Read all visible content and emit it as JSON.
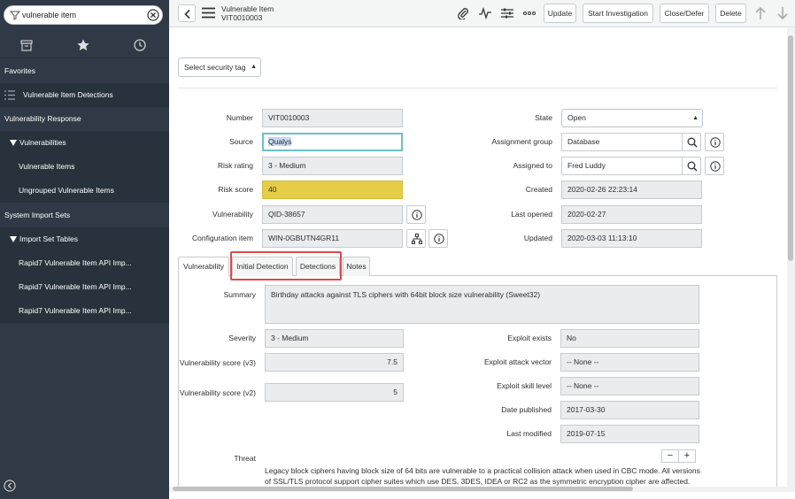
{
  "search": {
    "value": "vulnerable item"
  },
  "sidebar": {
    "items": [
      {
        "label": "Favorites"
      },
      {
        "label": "Vulnerable Item Detections"
      },
      {
        "label": "Vulnerability Response"
      },
      {
        "label": "Vulnerabilities"
      },
      {
        "label": "Vulnerable Items"
      },
      {
        "label": "Ungrouped Vulnerable Items"
      },
      {
        "label": "System Import Sets"
      },
      {
        "label": "Import Set Tables"
      },
      {
        "label": "Rapid7 Vulnerable Item API Imp..."
      },
      {
        "label": "Rapid7 Vulnerable Item API Imp..."
      },
      {
        "label": "Rapid7 Vulnerable Item API Imp..."
      }
    ]
  },
  "header": {
    "title": "Vulnerable Item",
    "subtitle": "VIT0010003",
    "buttons": {
      "update": "Update",
      "start_investigation": "Start Investigation",
      "close_defer": "Close/Defer",
      "delete": "Delete"
    }
  },
  "form": {
    "security_tag": "Select security tag",
    "number": {
      "label": "Number",
      "value": "VIT0010003"
    },
    "source": {
      "label": "Source",
      "value": "Qualys"
    },
    "risk_rating": {
      "label": "Risk rating",
      "value": "3 - Medium"
    },
    "risk_score": {
      "label": "Risk score",
      "value": "40"
    },
    "vulnerability": {
      "label": "Vulnerability",
      "value": "QID-38657"
    },
    "configuration_item": {
      "label": "Configuration item",
      "value": "WIN-0GBUTN4GR11"
    },
    "state": {
      "label": "State",
      "value": "Open"
    },
    "assignment_group": {
      "label": "Assignment group",
      "value": "Database"
    },
    "assigned_to": {
      "label": "Assigned to",
      "value": "Fred Luddy"
    },
    "created": {
      "label": "Created",
      "value": "2020-02-26 22:23:14"
    },
    "last_opened": {
      "label": "Last opened",
      "value": "2020-02-27"
    },
    "updated": {
      "label": "Updated",
      "value": "2020-03-03 11:13:10"
    }
  },
  "tabs": [
    {
      "label": "Vulnerability"
    },
    {
      "label": "Initial Detection"
    },
    {
      "label": "Detections"
    },
    {
      "label": "Notes"
    }
  ],
  "vuln_tab": {
    "summary": {
      "label": "Summary",
      "value": "Birthday attacks against TLS ciphers with 64bit block size vulnerability (Sweet32)"
    },
    "severity": {
      "label": "Severity",
      "value": "3 - Medium"
    },
    "score_v3": {
      "label": "Vulnerability score (v3)",
      "value": "7.5"
    },
    "score_v2": {
      "label": "Vulnerability score (v2)",
      "value": "5"
    },
    "exploit_exists": {
      "label": "Exploit exists",
      "value": "No"
    },
    "exploit_attack_vector": {
      "label": "Exploit attack vector",
      "value": "-- None --"
    },
    "exploit_skill_level": {
      "label": "Exploit skill level",
      "value": "-- None --"
    },
    "date_published": {
      "label": "Date published",
      "value": "2017-03-30"
    },
    "last_modified": {
      "label": "Last modified",
      "value": "2019-07-15"
    },
    "threat": {
      "label": "Threat",
      "value": "Legacy block ciphers having block size of 64 bits are vulnerable to a practical collision attack when used in CBC mode. All versions of SSL/TLS protocol support cipher suites which use DES, 3DES, IDEA or RC2 as the symmetric encryption cipher are affected."
    },
    "minus": "−",
    "plus": "+"
  },
  "colors": {
    "sidebar_bg": "#303a46",
    "highlight": "#e04848",
    "risk_score_bg": "#e5cd48",
    "focus_border": "#6ec1c8"
  },
  "icons": [
    "filter-icon",
    "clear-icon",
    "archive-icon",
    "star-icon",
    "history-icon",
    "back-icon",
    "menu-icon",
    "attachment-icon",
    "activity-icon",
    "settings-icon",
    "more-icon",
    "arrow-up-icon",
    "arrow-down-icon",
    "search-icon",
    "info-icon",
    "ci-map-icon"
  ]
}
